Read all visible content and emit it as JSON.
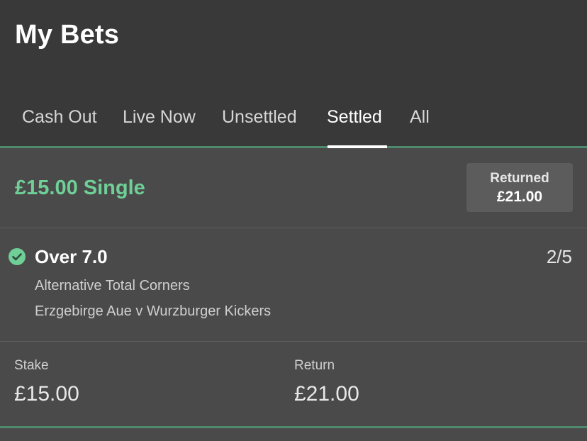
{
  "header": {
    "title": "My Bets"
  },
  "tabs": [
    {
      "label": "Cash Out",
      "active": false
    },
    {
      "label": "Live Now",
      "active": false
    },
    {
      "label": "Unsettled",
      "active": false
    },
    {
      "label": "Settled",
      "active": true
    },
    {
      "label": "All",
      "active": false
    }
  ],
  "bet": {
    "title": "£15.00 Single",
    "status_badge": {
      "label": "Returned",
      "value": "£21.00"
    },
    "selection": {
      "status_icon": "check-circle-icon",
      "name": "Over 7.0",
      "odds": "2/5",
      "market": "Alternative Total Corners",
      "event": "Erzgebirge Aue v Wurzburger Kickers"
    },
    "stake": {
      "label": "Stake",
      "value": "£15.00"
    },
    "return": {
      "label": "Return",
      "value": "£21.00"
    }
  },
  "colors": {
    "header_bg": "#393939",
    "body_bg": "#4a4a4a",
    "accent_green": "#6fcf97",
    "divider_green": "#4f8a6e",
    "badge_bg": "#5c5c5c"
  }
}
